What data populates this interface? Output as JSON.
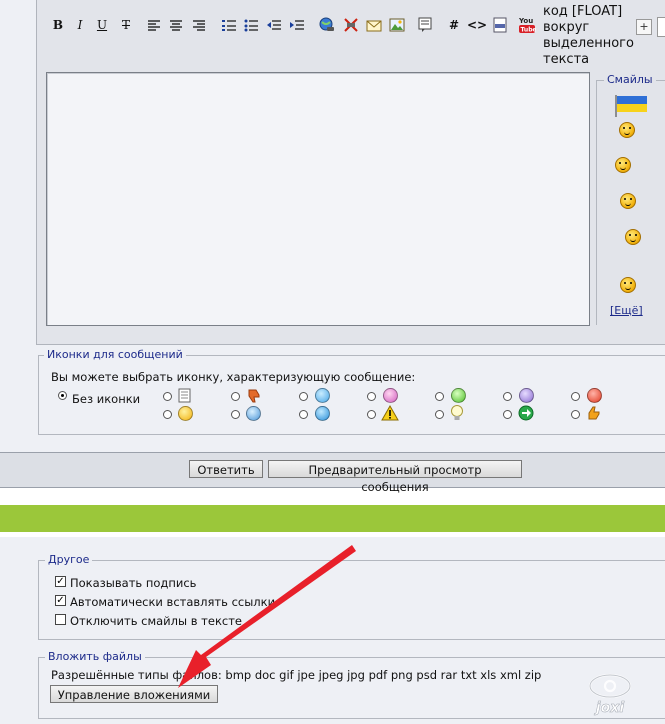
{
  "toolbar": {
    "tooltip": "код [FLOAT] вокруг выделенного текста",
    "plus": "+"
  },
  "smilies": {
    "legend": "Смайлы",
    "more": "[Ещё]"
  },
  "post_icons": {
    "legend": "Иконки для сообщений",
    "hint": "Вы можете выбрать иконку, характеризующую сообщение:",
    "none_label": "Без иконки"
  },
  "buttons": {
    "reply": "Ответить",
    "preview": "Предварительный просмотр сообщения",
    "manage_attachments": "Управление вложениями"
  },
  "other": {
    "legend": "Другое",
    "options": [
      {
        "label": "Показывать подпись",
        "checked": true
      },
      {
        "label": "Автоматически вставлять ссылки",
        "checked": true
      },
      {
        "label": "Отключить смайлы в тексте",
        "checked": false
      }
    ]
  },
  "attachments": {
    "legend": "Вложить файлы",
    "types": "Разрешённые типы файлов: bmp doc gif jpe jpeg jpg pdf png psd rar txt xls xml zip"
  },
  "watermark": "joxi",
  "colors": {
    "accent_green": "#9bc73a",
    "arrow_red": "#e8202a",
    "legend_blue": "#1c2a8a"
  }
}
